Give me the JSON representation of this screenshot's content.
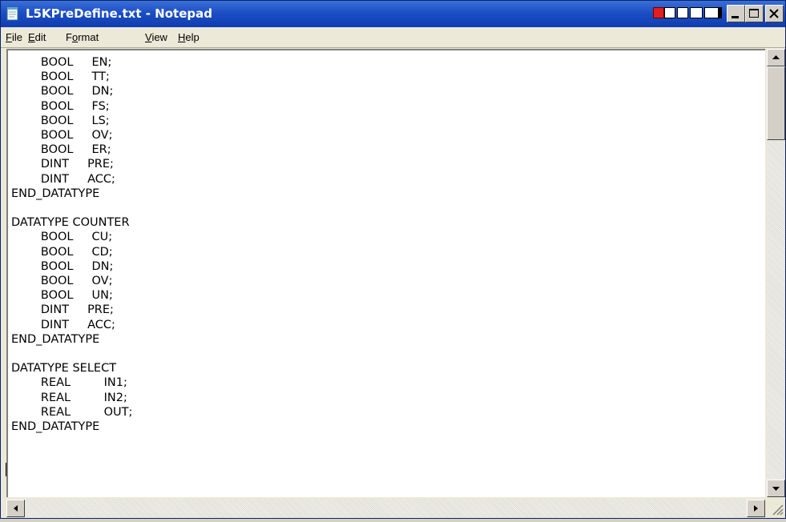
{
  "window": {
    "title": "L5KPreDefine.txt - Notepad"
  },
  "menu": {
    "items": [
      {
        "label": "File",
        "mnemonic": "F",
        "rest": "ile"
      },
      {
        "label": "Edit",
        "mnemonic": "E",
        "rest": "dit"
      },
      {
        "label": "Format",
        "mnemonic": "o",
        "prefix": "F",
        "rest": "rmat"
      },
      {
        "label": "View",
        "mnemonic": "V",
        "rest": "iew"
      },
      {
        "label": "Help",
        "mnemonic": "H",
        "rest": "elp"
      }
    ]
  },
  "editor": {
    "content": "        BOOL     EN;\n        BOOL     TT;\n        BOOL     DN;\n        BOOL     FS;\n        BOOL     LS;\n        BOOL     OV;\n        BOOL     ER;\n        DINT     PRE;\n        DINT     ACC;\nEND_DATATYPE\n\nDATATYPE COUNTER\n        BOOL     CU;\n        BOOL     CD;\n        BOOL     DN;\n        BOOL     OV;\n        BOOL     UN;\n        DINT     PRE;\n        DINT     ACC;\nEND_DATATYPE\n\nDATATYPE SELECT\n        REAL         IN1;\n        REAL         IN2;\n        REAL         OUT;\nEND_DATATYPE"
  },
  "icons": {
    "app": "notepad-icon",
    "minimize": "minimize-icon",
    "maximize": "maximize-icon",
    "close": "close-icon"
  },
  "colors": {
    "titlebar": "#1c4fc4",
    "title_text": "#ffffff",
    "chrome": "#ece9d8",
    "editor_bg": "#ffffff"
  }
}
